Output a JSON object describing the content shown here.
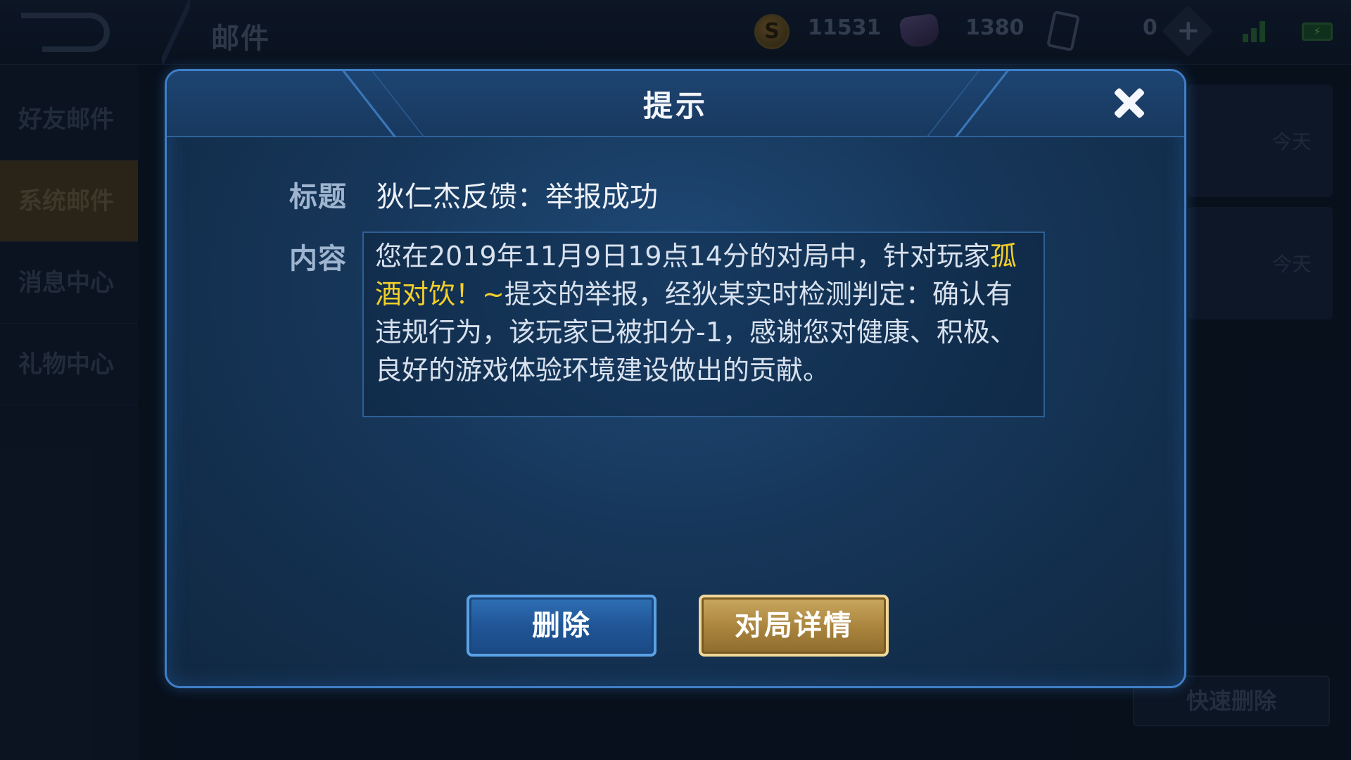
{
  "topbar": {
    "title": "邮件",
    "gold": "11531",
    "gems": "1380",
    "cards": "0"
  },
  "sidebar": {
    "items": [
      {
        "label": "好友邮件",
        "active": false
      },
      {
        "label": "系统邮件",
        "active": true
      },
      {
        "label": "消息中心",
        "active": false
      },
      {
        "label": "礼物中心",
        "active": false
      }
    ]
  },
  "mail_list": {
    "dates": [
      "今天",
      "今天"
    ],
    "quick_delete_label": "快速删除"
  },
  "dialog": {
    "title": "提示",
    "subject_label": "标题",
    "subject": "狄仁杰反馈：举报成功",
    "content_label": "内容",
    "content_before": "您在2019年11月9日19点14分的对局中，针对玩家",
    "content_player": "孤酒对饮！~",
    "content_after": "提交的举报，经狄某实时检测判定：确认有违规行为，该玩家已被扣分-1，感谢您对健康、积极、良好的游戏体验环境建设做出的贡献。",
    "delete_label": "删除",
    "detail_label": "对局详情"
  },
  "icons": [
    "back-icon",
    "gold-coin-icon",
    "gem-icon",
    "card-icon",
    "plus-icon",
    "signal-icon",
    "battery-icon",
    "close-icon"
  ],
  "colors": {
    "highlight": "#f4cf2a",
    "dialog_border": "#3f7fc8",
    "gold_button": "#a8833c",
    "blue_button": "#1f5495"
  }
}
